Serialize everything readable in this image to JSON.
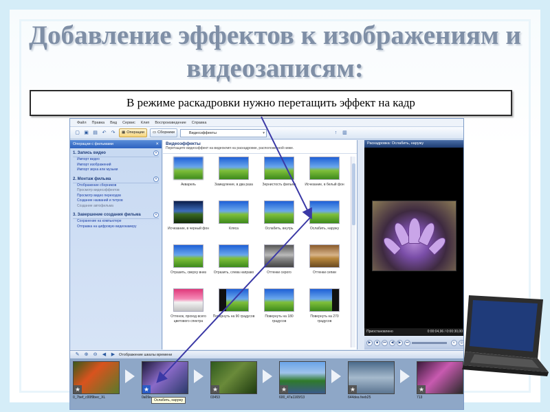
{
  "slide": {
    "title": "Добавление эффектов к изображениям и видеозаписям:",
    "instruction": "В режиме раскадровки нужно перетащить эффект на кадр"
  },
  "app": {
    "menu": [
      "Файл",
      "Правка",
      "Вид",
      "Сервис",
      "Клип",
      "Воспроизведение",
      "Справка"
    ],
    "toolbar": {
      "operations": "Операции",
      "collections": "Сборники",
      "address": "Видеоэффекты"
    },
    "taskpane": {
      "header": "Операции с фильмами",
      "sections": [
        {
          "title": "1. Запись видео",
          "links": [
            {
              "label": "Импорт видео",
              "muted": false
            },
            {
              "label": "Импорт изображений",
              "muted": false
            },
            {
              "label": "Импорт звука или музыки",
              "muted": false
            }
          ]
        },
        {
          "title": "2. Монтаж фильма",
          "links": [
            {
              "label": "Отображение сборников",
              "muted": false
            },
            {
              "label": "Просмотр видеоэффектов",
              "muted": true
            },
            {
              "label": "Просмотр видео переходов",
              "muted": false
            },
            {
              "label": "Создание названий и титров",
              "muted": false
            },
            {
              "label": "Создание автофильма",
              "muted": true
            }
          ]
        },
        {
          "title": "3. Завершение создания фильма",
          "links": [
            {
              "label": "Сохранение на компьютере",
              "muted": false
            },
            {
              "label": "Отправка на цифровую видеокамеру",
              "muted": false
            }
          ]
        }
      ]
    },
    "content": {
      "title": "Видеоэффекты",
      "subtitle": "Перетащите видеоэффект на видеоклип на раскадровке, расположенной ниже.",
      "effects": [
        {
          "label": "Акварель",
          "style": "blur"
        },
        {
          "label": "Замедление, в два раза",
          "style": ""
        },
        {
          "label": "Зернистость фильма",
          "style": ""
        },
        {
          "label": "Исчезание, в белый фон",
          "style": ""
        },
        {
          "label": "Исчезание, в черный фон",
          "style": "dark"
        },
        {
          "label": "Кляса",
          "style": ""
        },
        {
          "label": "Ослабить, внутрь",
          "style": ""
        },
        {
          "label": "Ослабить, наружу",
          "style": ""
        },
        {
          "label": "Отразить, сверху вниз",
          "style": ""
        },
        {
          "label": "Отразить, слева направо",
          "style": ""
        },
        {
          "label": "Оттенки серого",
          "style": "gray"
        },
        {
          "label": "Оттенки сепии",
          "style": "sepia"
        },
        {
          "label": "Оттенок, проход всего цветового спектра",
          "style": "pink"
        },
        {
          "label": "Повернуть на 90 градусов",
          "style": "rot"
        },
        {
          "label": "Повернуть на 180 градусов",
          "style": ""
        },
        {
          "label": "Повернуть на 270 градусов",
          "style": "rot2"
        }
      ]
    },
    "preview": {
      "title": "Раскадровка: Ослабить, наружу",
      "status": "Приостановлено",
      "time": "0:00:04,96 / 0:00:30,00"
    },
    "storyboard": {
      "toolbar_label": "Отображение шкалы времени",
      "clips": [
        {
          "name": "0_7bef_c00f9bec_XL",
          "effect": false
        },
        {
          "name": "0a09e",
          "effect": true
        },
        {
          "name": "03453",
          "effect": false
        },
        {
          "name": "600_47a1165f13",
          "effect": false
        },
        {
          "name": "644dea feeb25",
          "effect": false
        },
        {
          "name": "713",
          "effect": false
        }
      ],
      "tooltip": "Ослабить, наружу"
    }
  },
  "icons": [
    "new-project-icon",
    "open-icon",
    "save-icon",
    "undo-icon",
    "redo-icon",
    "close-icon",
    "chevron-up-icon",
    "play-icon",
    "star-icon",
    "laptop-icon"
  ]
}
